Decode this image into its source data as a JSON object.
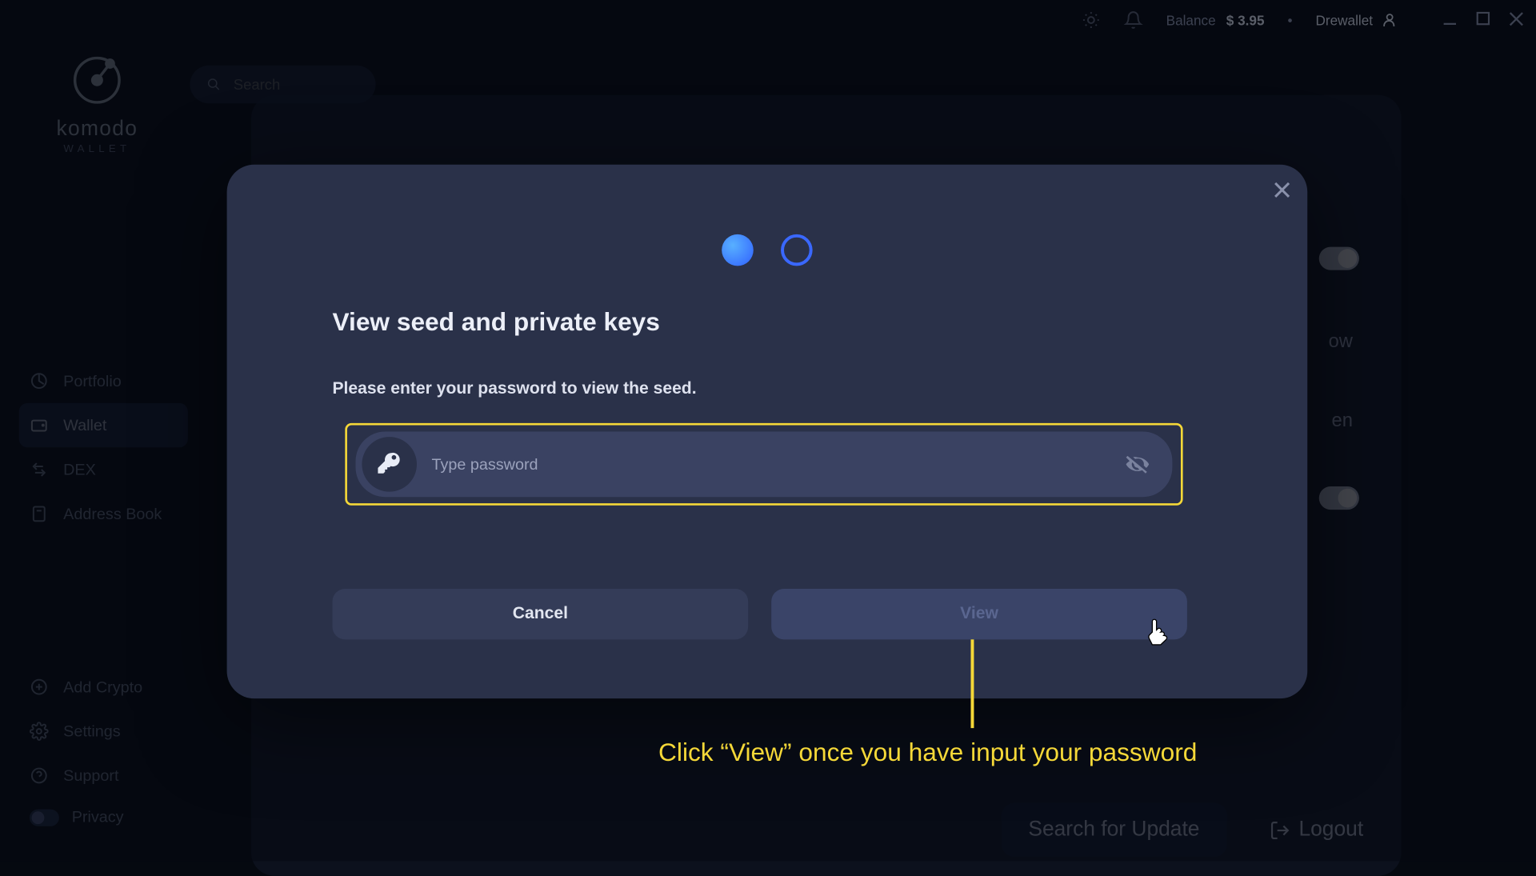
{
  "app": {
    "name": "komodo",
    "sub": "WALLET"
  },
  "topbar": {
    "balance_label": "Balance",
    "balance_value": "$ 3.95",
    "user": "Drewallet"
  },
  "search": {
    "placeholder": "Search"
  },
  "sidebar": {
    "items": [
      {
        "label": "Portfolio"
      },
      {
        "label": "Wallet"
      },
      {
        "label": "DEX"
      },
      {
        "label": "Address Book"
      }
    ],
    "bottom": [
      {
        "label": "Add Crypto"
      },
      {
        "label": "Settings"
      },
      {
        "label": "Support"
      },
      {
        "label": "Privacy"
      }
    ]
  },
  "bg_panel": {
    "row1": "ow",
    "row2": "en",
    "search_update": "Search for Update",
    "logout": "Logout"
  },
  "dialog": {
    "title": "View seed and private keys",
    "sub": "Please enter your password to view the seed.",
    "placeholder": "Type password",
    "cancel": "Cancel",
    "view": "View"
  },
  "annotation": "Click “View” once you have input your password"
}
